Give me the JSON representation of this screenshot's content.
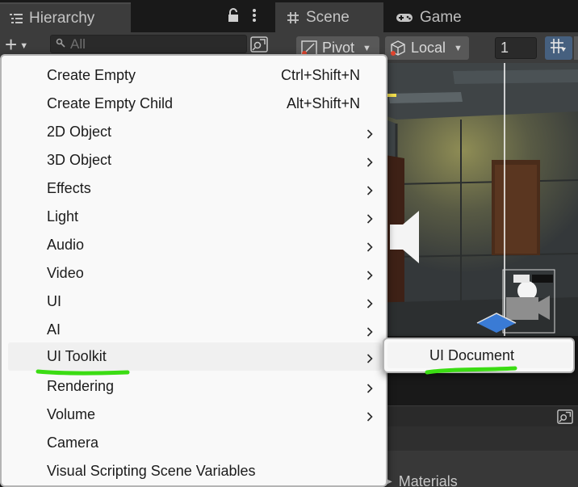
{
  "tabs": {
    "hierarchy": {
      "label": "Hierarchy",
      "icon": "list-icon"
    },
    "scene": {
      "label": "Scene",
      "icon": "hash-icon"
    },
    "game": {
      "label": "Game",
      "icon": "gamepad-icon"
    }
  },
  "hierarchy_toolbar": {
    "add_button_label": "+",
    "search_placeholder": "All"
  },
  "scene_toolbar": {
    "pivot_label": "Pivot",
    "local_label": "Local",
    "grid_value": "1"
  },
  "context_menu": {
    "items": [
      {
        "label": "Create Empty",
        "shortcut": "Ctrl+Shift+N",
        "has_submenu": false
      },
      {
        "label": "Create Empty Child",
        "shortcut": "Alt+Shift+N",
        "has_submenu": false
      },
      {
        "label": "2D Object",
        "has_submenu": true
      },
      {
        "label": "3D Object",
        "has_submenu": true
      },
      {
        "label": "Effects",
        "has_submenu": true
      },
      {
        "label": "Light",
        "has_submenu": true
      },
      {
        "label": "Audio",
        "has_submenu": true
      },
      {
        "label": "Video",
        "has_submenu": true
      },
      {
        "label": "UI",
        "has_submenu": true
      },
      {
        "label": "AI",
        "has_submenu": true
      },
      {
        "label": "UI Toolkit",
        "has_submenu": true,
        "highlighted": true
      },
      {
        "label": "Rendering",
        "has_submenu": true
      },
      {
        "label": "Volume",
        "has_submenu": true
      },
      {
        "label": "Camera",
        "has_submenu": false
      },
      {
        "label": "Visual Scripting Scene Variables",
        "has_submenu": false
      }
    ]
  },
  "submenu": {
    "items": [
      {
        "label": "UI Document"
      }
    ]
  },
  "lower_panel": {
    "section_label": "Materials"
  },
  "colors": {
    "editor_bg": "#1e1e1e",
    "panel_bg": "#3c3c3c",
    "menu_bg": "#f9f9f9",
    "menu_text": "#1b1b1b",
    "annotation_green": "#3bdc13",
    "accent_blue": "#46607f"
  }
}
